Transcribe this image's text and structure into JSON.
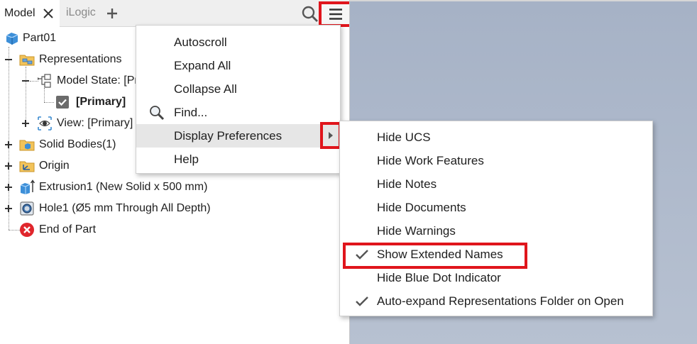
{
  "tabs": {
    "model_label": "Model",
    "ilogic_label": "iLogic"
  },
  "tree": {
    "part": "Part01",
    "representations": "Representations",
    "model_state": "Model State: [Pr",
    "primary": "[Primary]",
    "view": "View: [Primary]",
    "solid_bodies": "Solid Bodies(1)",
    "origin": "Origin",
    "extrusion": "Extrusion1 (New Solid x 500 mm)",
    "hole": "Hole1 (Ø5 mm Through All Depth)",
    "end_of_part": "End of Part"
  },
  "menu": {
    "items": [
      {
        "label": "Autoscroll"
      },
      {
        "label": "Expand All"
      },
      {
        "label": "Collapse All"
      },
      {
        "label": "Find...",
        "icon": "magnifier-icon"
      },
      {
        "label": "Display Preferences",
        "has_submenu": true
      },
      {
        "label": "Help"
      }
    ]
  },
  "submenu": {
    "items": [
      {
        "label": "Hide UCS",
        "checked": false
      },
      {
        "label": "Hide Work Features",
        "checked": false
      },
      {
        "label": "Hide Notes",
        "checked": false
      },
      {
        "label": "Hide Documents",
        "checked": false
      },
      {
        "label": "Hide Warnings",
        "checked": false
      },
      {
        "label": "Show Extended Names",
        "checked": true
      },
      {
        "label": "Hide Blue Dot Indicator",
        "checked": false
      },
      {
        "label": "Auto-expand Representations Folder on Open",
        "checked": true
      }
    ]
  },
  "colors": {
    "highlight_red": "#e0151c",
    "menu_hover": "#e6e6e6",
    "viewport_bg": "#a6b2c6"
  }
}
